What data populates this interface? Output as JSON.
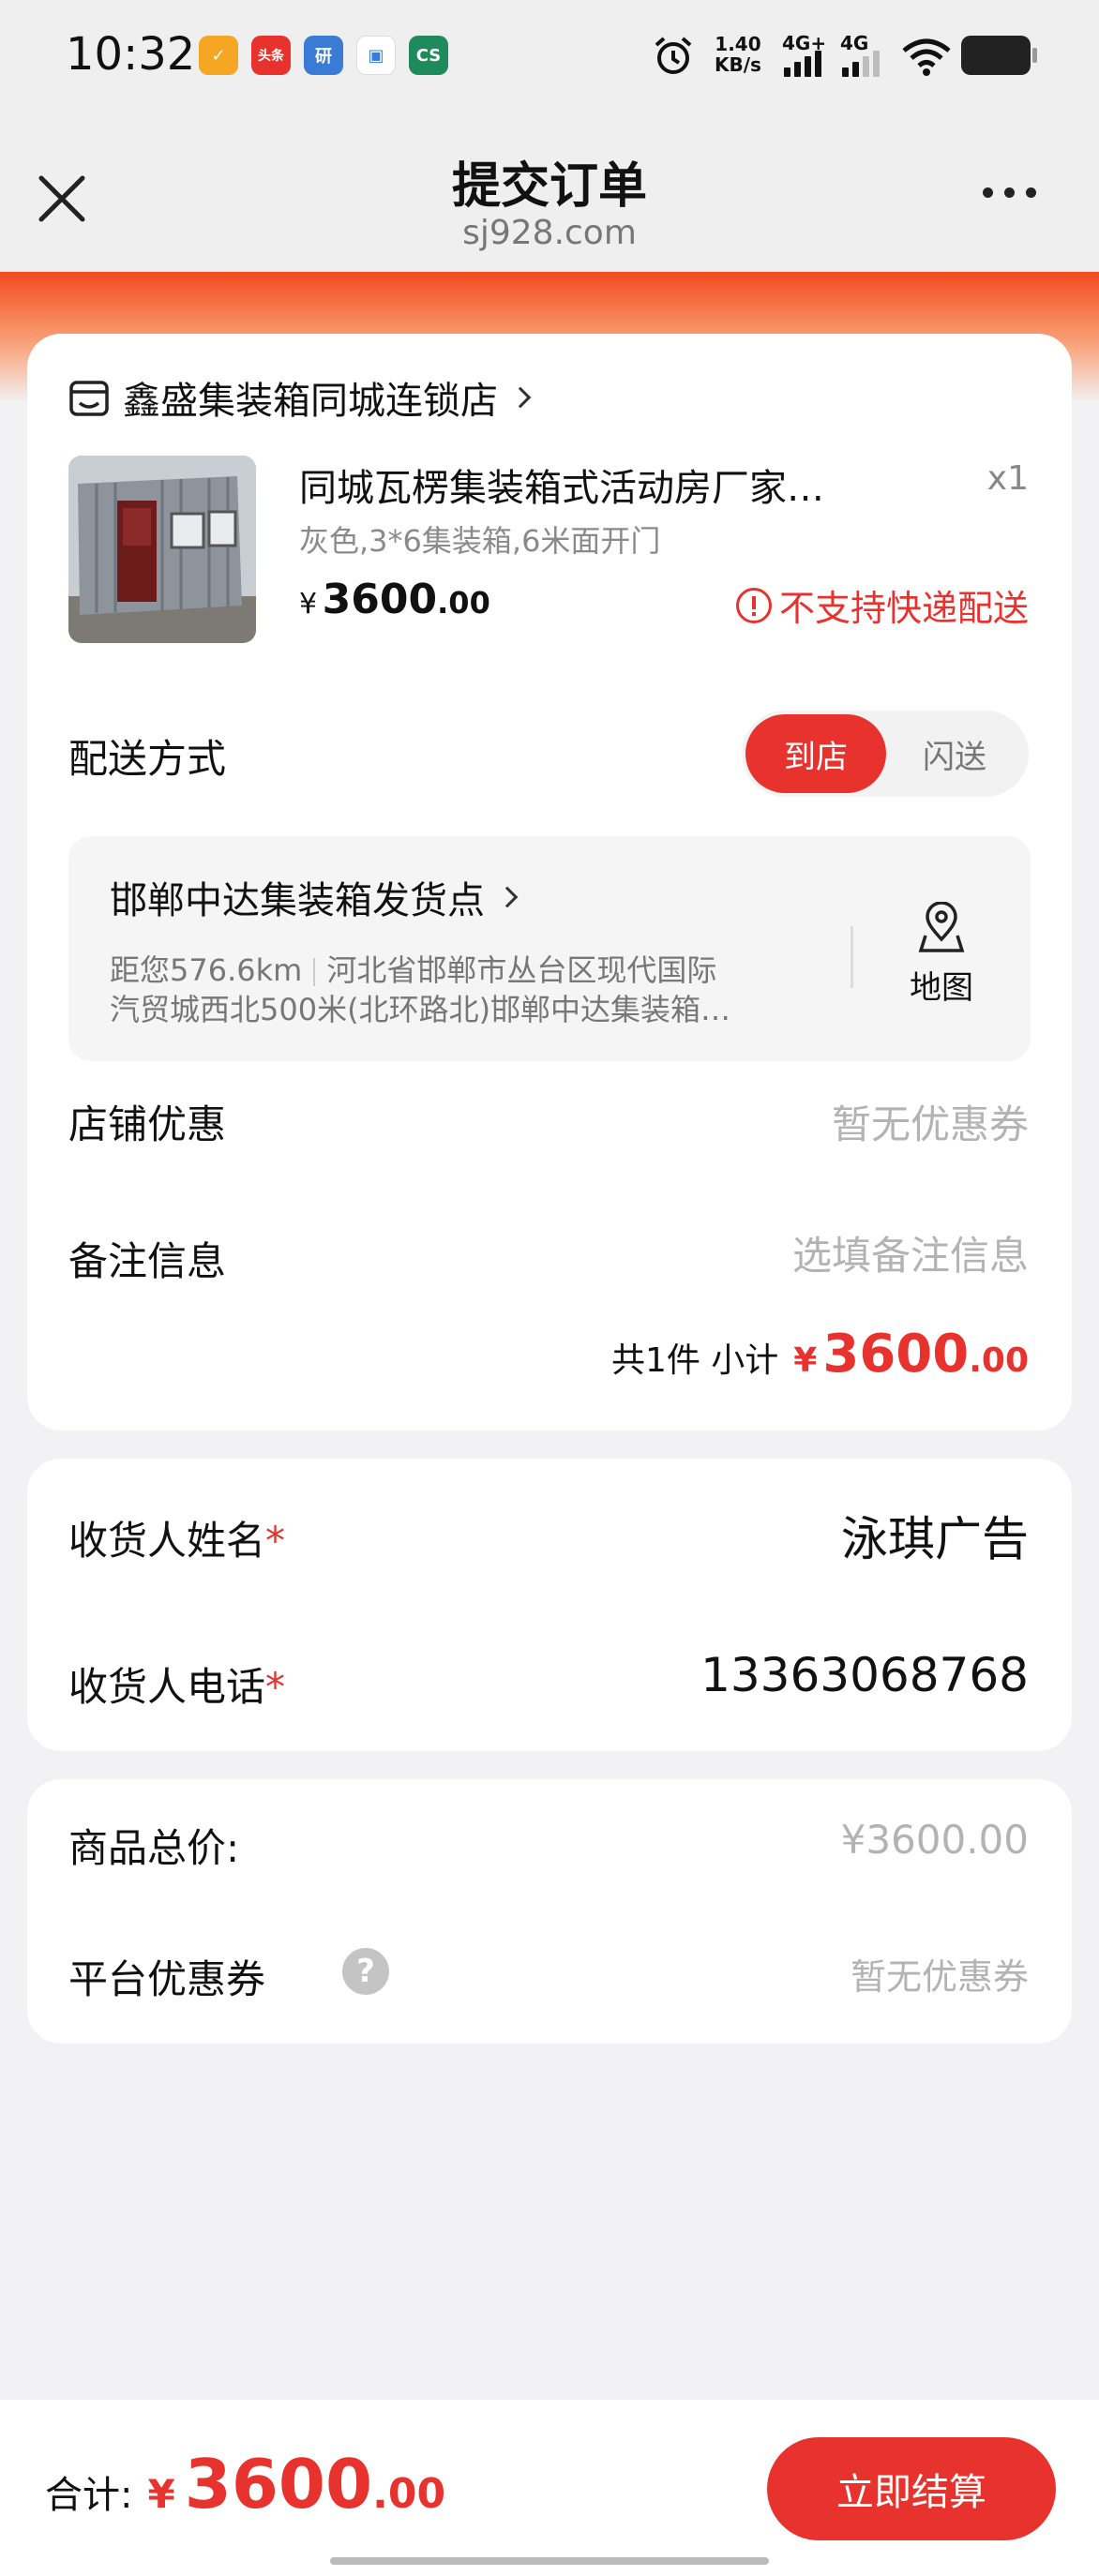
{
  "status_bar": {
    "time": "10:32",
    "apps": [
      {
        "icon": "app-icon-orange",
        "color": "#f5a623",
        "glyph": "✓"
      },
      {
        "icon": "toutiao-icon",
        "color": "#e8322d",
        "glyph": "头条"
      },
      {
        "icon": "research-icon",
        "color": "#3a7bd5",
        "glyph": "研"
      },
      {
        "icon": "chat-icon",
        "color": "#ffffff",
        "glyph": "▣"
      },
      {
        "icon": "cs-icon",
        "color": "#1f8a5b",
        "glyph": "CS"
      }
    ],
    "net_speed": "1.40",
    "net_speed_unit": "KB/s",
    "net1": "4G+",
    "net2": "4G"
  },
  "header": {
    "title": "提交订单",
    "subtitle": "sj928.com"
  },
  "order": {
    "store_name": "鑫盛集装箱同城连锁店",
    "product_name": "同城瓦楞集装箱式活动房厂家…",
    "quantity": "x1",
    "spec": "灰色,3*6集装箱,6米面开门",
    "price_currency": "¥",
    "price_int": "3600",
    "price_dec": ".00",
    "delivery_notice": "不支持快递配送",
    "delivery_label": "配送方式",
    "delivery_options": [
      "到店",
      "闪送"
    ],
    "pickup": {
      "name": "邯郸中达集装箱发货点",
      "distance": "距您576.6km",
      "address_line1": "河北省邯郸市丛台区现代国际",
      "address_line2": "汽贸城西北500米(北环路北)邯郸中达集装箱…",
      "map_label": "地图"
    },
    "coupon_label": "店铺优惠",
    "coupon_value": "暂无优惠券",
    "note_label": "备注信息",
    "note_placeholder": "选填备注信息",
    "subtotal_label": "共1件 小计",
    "subtotal_currency": "¥",
    "subtotal_int": "3600",
    "subtotal_dec": ".00"
  },
  "recipient": {
    "name_label": "收货人姓名",
    "name_value": "泳琪广告",
    "phone_label": "收货人电话",
    "phone_value": "13363068768",
    "required_mark": "*"
  },
  "summary": {
    "goods_total_label": "商品总价:",
    "goods_total_value": "¥3600.00",
    "platform_coupon_label": "平台优惠券",
    "help_glyph": "?",
    "platform_coupon_value": "暂无优惠券"
  },
  "bottom": {
    "total_label": "合计:",
    "total_currency": "¥",
    "total_int": "3600",
    "total_dec": ".00",
    "checkout_label": "立即结算"
  },
  "colors": {
    "accent": "#e8322d",
    "background": "#f2f2f4"
  }
}
